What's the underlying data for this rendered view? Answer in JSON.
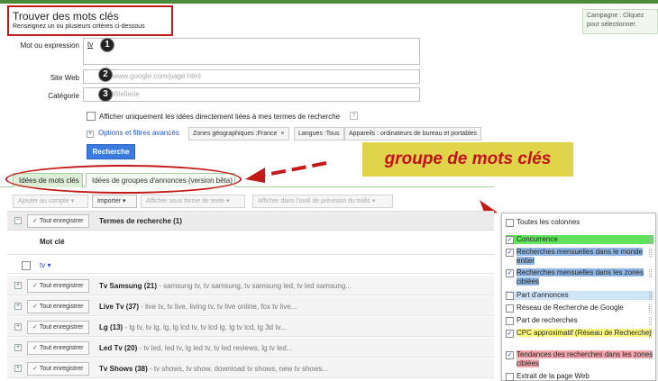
{
  "header": {
    "title": "Trouver des mots clés",
    "subtitle": "Renseignez un ou plusieurs critères ci-dessous",
    "campaign_note": "Campagne : Cliquez pour sélectionner."
  },
  "form": {
    "keyword_label": "Mot ou expression",
    "keyword_value": "tv",
    "website_label": "Site Web",
    "website_placeholder": "www.google.com/page.html",
    "category_label": "Catégorie",
    "category_placeholder": "Hôtellerie",
    "markers": [
      "1",
      "2",
      "3"
    ],
    "only_related_label": "Afficher uniquement les idées directement liées à mes termes de recherche",
    "help_glyph": "?",
    "advanced_link": "Options et filtres avancés",
    "filters": [
      {
        "label": "Zones géographiques :France",
        "remove": "×"
      },
      {
        "label": "Langues :Tous",
        "remove": ""
      },
      {
        "label": "Appareils : ordinateurs de bureau et portables",
        "remove": ""
      }
    ],
    "search_button": "Recherche"
  },
  "annotation": {
    "text": "groupe de mots clés"
  },
  "tabs": [
    {
      "label": "Idées de mots clés",
      "active": true
    },
    {
      "label": "Idées de groupes d'annonces (version bêta)",
      "active": false
    }
  ],
  "toolbar": {
    "add_to_account": "Ajouter au compte",
    "import": "Importer",
    "show_as_text": "Afficher sous forme de texte",
    "traffic_estimator": "Afficher dans l'outil de prévision du trafic"
  },
  "table": {
    "add_all_label": "Tout enregistrer",
    "check_glyph": "✓",
    "search_terms_header": "Termes de recherche (1)",
    "keyword_col_header": "Mot clé",
    "tv_term": "tv",
    "rows": [
      {
        "group": "Tv Samsung (21)",
        "keywords": " - samsung tv, tv samsung, tv samsung led, tv led samsung..."
      },
      {
        "group": "Live Tv (37)",
        "keywords": " - live tv, tv live, living tv, tv live online, fox tv live..."
      },
      {
        "group": "Lg (13)",
        "keywords": " - lg tv, tv lg, lg, lg lcd tv, tv lcd lg, lg tv lcd, lg 3d tv..."
      },
      {
        "group": "Led Tv (20)",
        "keywords": " - tv led, led tv, lg led tv, tv led reviews, lg tv led..."
      },
      {
        "group": "Tv Shows (38)",
        "keywords": " - tv shows, tv show, download tv shows, new tv shows..."
      }
    ]
  },
  "columns_panel": {
    "items": [
      {
        "label": "Toutes les colonnes",
        "checked": false,
        "highlight": ""
      },
      {
        "label": "Concurrence",
        "checked": true,
        "highlight": "green"
      },
      {
        "label": "Recherches mensuelles dans le monde entier",
        "checked": true,
        "highlight": "blue"
      },
      {
        "label": "Recherches mensuelles dans les zones ciblées",
        "checked": true,
        "highlight": "blue"
      },
      {
        "label": "Part d'annonces",
        "checked": false,
        "highlight": "lightblue"
      },
      {
        "label": "Réseau de Recherche de Google",
        "checked": false,
        "highlight": ""
      },
      {
        "label": "Part de recherches",
        "checked": false,
        "highlight": ""
      },
      {
        "label": "CPC approximatif (Réseau de Recherche)",
        "checked": true,
        "highlight": "yellow"
      },
      {
        "label": "Tendances des recherches dans les zones ciblées",
        "checked": true,
        "highlight": "pink"
      },
      {
        "label": "Extrait de la page Web",
        "checked": false,
        "highlight": ""
      }
    ]
  },
  "colors": {
    "accent_blue": "#3b7ae0",
    "annotation_red": "#c41a1a",
    "annotation_yellow": "#e0d54a",
    "tab_green": "#a8cfa0"
  }
}
